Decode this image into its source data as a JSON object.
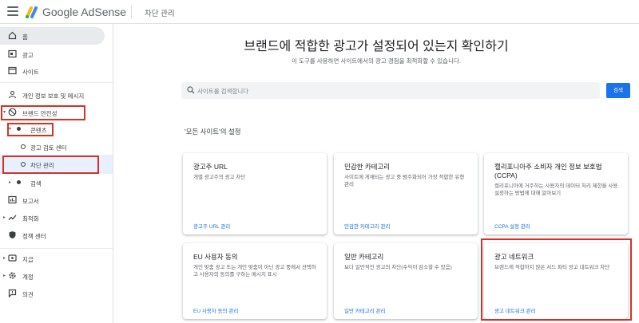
{
  "header": {
    "product": "Google AdSense",
    "page_title": "차단 관리"
  },
  "sidebar": {
    "items": [
      {
        "label": "홈",
        "icon": "home-icon"
      },
      {
        "label": "광고",
        "icon": "ads-icon"
      },
      {
        "label": "사이트",
        "icon": "sites-icon"
      },
      {
        "label": "개인 정보 보호 및 메시지",
        "icon": "privacy-messaging-icon"
      },
      {
        "label": "브랜드 안전성",
        "icon": "brand-safety-icon"
      },
      {
        "label": "콘텐츠",
        "icon": "content-icon"
      },
      {
        "label": "광고 검토 센터",
        "icon": "ad-review-icon"
      },
      {
        "label": "차단 관리",
        "icon": "blocking-controls-icon"
      },
      {
        "label": "검색",
        "icon": "search-nav-icon"
      },
      {
        "label": "보고서",
        "icon": "reports-icon"
      },
      {
        "label": "최적화",
        "icon": "optimization-icon"
      },
      {
        "label": "정책 센터",
        "icon": "policy-center-icon"
      },
      {
        "label": "지급",
        "icon": "payments-icon"
      },
      {
        "label": "계정",
        "icon": "account-icon"
      },
      {
        "label": "의견",
        "icon": "feedback-icon"
      }
    ]
  },
  "main": {
    "title": "브랜드에 적합한 광고가 설정되어 있는지 확인하기",
    "subtitle": "이 도구를 사용하면 사이트에서의 광고 경험을 최적화할 수 있습니다.",
    "search_placeholder": "사이트를 검색합니다",
    "search_button": "검색",
    "section_title": "'모든 사이트'의 설정",
    "cards": [
      {
        "title": "광고주 URL",
        "desc": "개별 광고주의 광고 차단",
        "link": "광고주 URL 관리"
      },
      {
        "title": "민감한 카테고리",
        "desc": "사이트에 게재되는 광고 중 범주화되어 가장 적합한 유형 관리",
        "link": "민감한 카테고리 관리"
      },
      {
        "title": "캘리포니아주 소비자 개인 정보 보호법(CCPA)",
        "desc": "캘리포니아에 거주하는 사용자의 데이터 처리 제한을 사용 설정하는 방법에 대해 알아보기",
        "link": "CCPA 설정 관리"
      },
      {
        "title": "EU 사용자 동의",
        "desc": "개인 맞춤 광고 또는 개인 맞춤이 아닌 광고 중에서 선택하고 사용자의 동의를 구하는 메시지 표시",
        "link": "EU 사용자 동의 관리"
      },
      {
        "title": "일반 카테고리",
        "desc": "보다 일반적인 광고의 차단(수익이 감소할 수 있음)",
        "link": "일반 카테고리 관리"
      },
      {
        "title": "광고 네트워크",
        "desc": "브랜드에 적합하지 않은 서드 파티 광고 네트워크 차단",
        "link": "광고 네트워크 관리"
      }
    ]
  },
  "colors": {
    "accent": "#1a73e8",
    "highlight": "#d93025",
    "active_bg": "#e8f0fe"
  }
}
